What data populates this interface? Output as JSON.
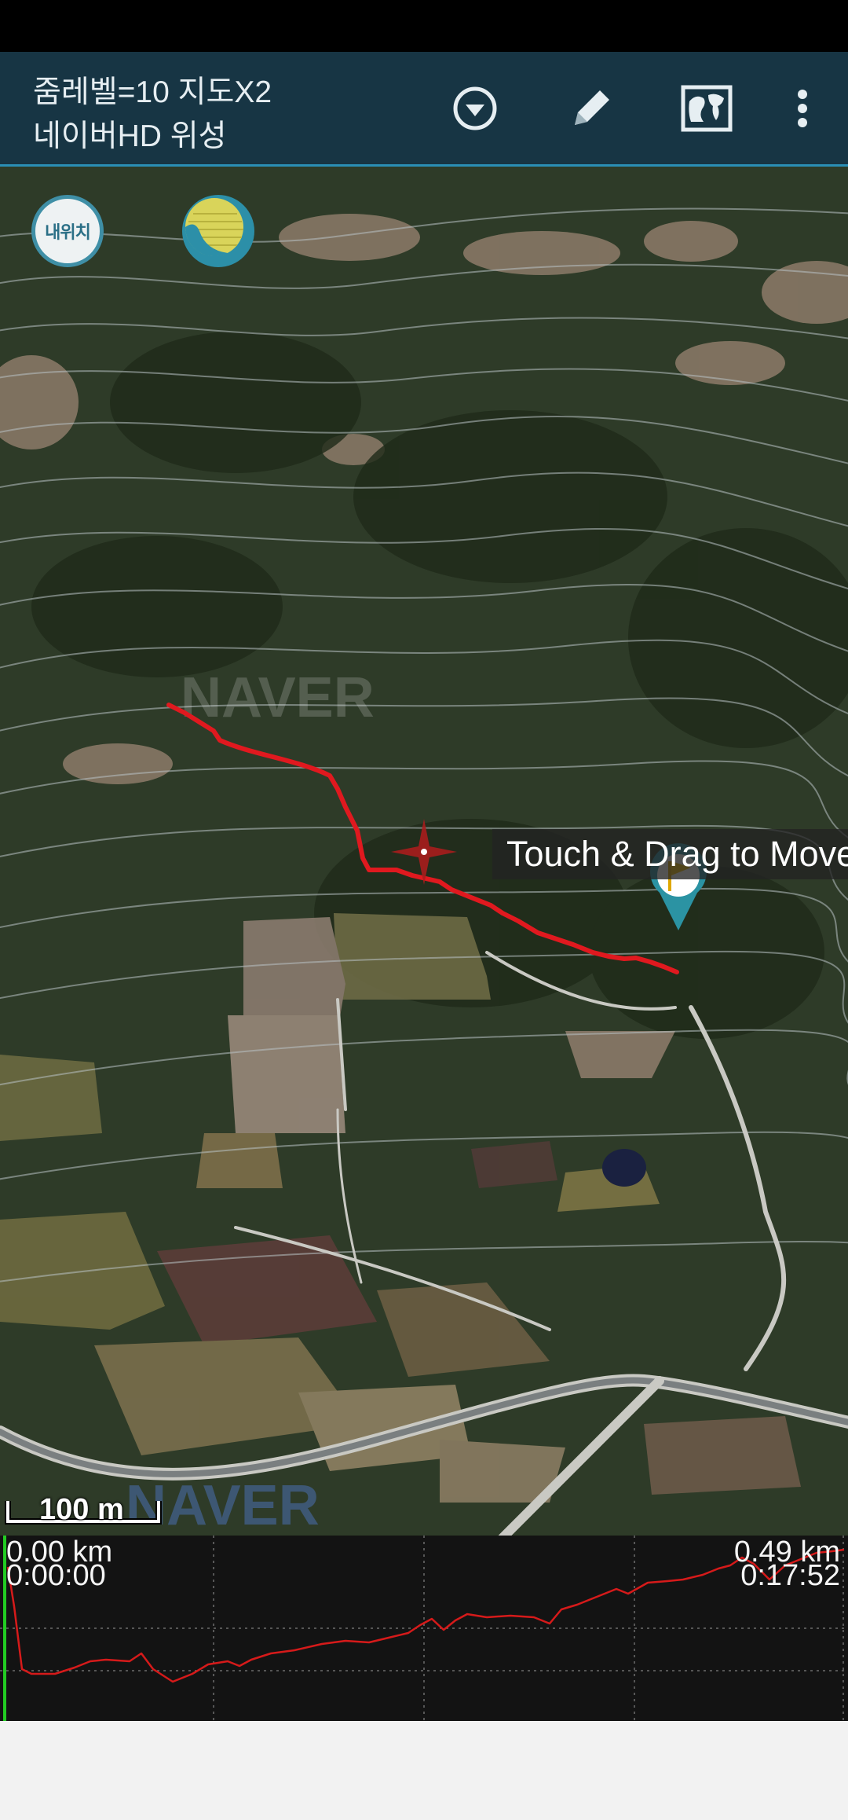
{
  "app_bar": {
    "title_line1": "줌레벨=10 지도X2",
    "title_line2": "네이버HD 위성",
    "actions": [
      {
        "name": "dropdown-circle-icon"
      },
      {
        "name": "pencil-icon"
      },
      {
        "name": "map-view-icon"
      },
      {
        "name": "more-vert-icon"
      }
    ],
    "colors": {
      "background": "#173544",
      "accent": "#2a8fb5"
    }
  },
  "map": {
    "my_location_label": "내위치",
    "toast": "Touch & Drag to Move",
    "scale_label": "100 m",
    "watermark": "NAVER",
    "track_color": "#e0191f",
    "marker_icon": "flag-pin-icon",
    "crosshair_icon": "crosshair-icon",
    "layer_icon": "layer-toggle-icon"
  },
  "elevation_profile": {
    "start_distance": "0.00 km",
    "start_time": "0:00:00",
    "end_distance": "0.49 km",
    "end_time": "0:17:52",
    "line_color": "#d61a1a",
    "cursor_color": "#22cc22"
  }
}
